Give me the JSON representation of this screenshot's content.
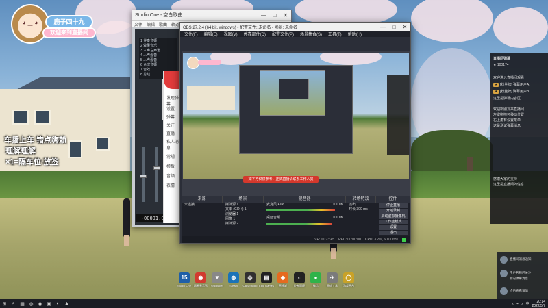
{
  "streamer": {
    "name": "鹿子四十九",
    "subtitle": "欢迎来到直播间",
    "avatar_face": "◕ ‿ ◕",
    "banner_line1": "车播上车 错点嗨赖",
    "banner_line2": "理解理解",
    "banner_line3": "×1=隔车位·放签"
  },
  "studio_one": {
    "title": "Studio One - 空白歌曲",
    "menu": [
      "文件",
      "编辑",
      "歌曲",
      "轨道",
      "事件",
      "音频",
      "视图"
    ],
    "tracks": [
      "1 伴奏音频",
      "2 效果音乐",
      "3 人声左声道",
      "4 人声混音",
      "5 人声混音",
      "6 合成音频",
      "7 音效",
      "8 总线"
    ],
    "time_display": "-00001.03.0"
  },
  "chat_settings": {
    "items": [
      "发现弹幕",
      "设置",
      "弹幕",
      "关注",
      "直播",
      "私人消息",
      "常规",
      "模板",
      "音频",
      "表情"
    ]
  },
  "obs": {
    "title": "OBS 27.2.4 (64 bit, windows) - 配置文件: 未命名 - 场景: 未命名",
    "menu": [
      "文件(F)",
      "编辑(E)",
      "视图(V)",
      "停靠部件(D)",
      "配置文件(P)",
      "场景集合(S)",
      "工具(T)",
      "帮助(H)"
    ],
    "preview_banner": "如下方仅供参考，正式直播请联系工作人员",
    "dock_headers": [
      "来源",
      "场景",
      "混音器",
      "转场特效",
      "控件"
    ],
    "sources_title": "未连接",
    "scenes": [
      "媒体源 1",
      "文本 (GDI+) 1",
      "浏览器 1",
      "图像 1",
      "媒体源 2"
    ],
    "mixer": [
      {
        "label": "麦克风/Aux",
        "value": "0.0 dB"
      },
      {
        "label": "桌面音频",
        "value": "0.0 dB"
      }
    ],
    "transition": {
      "type": "淡出",
      "duration_label": "时长",
      "duration_value": "300 ms"
    },
    "controls": [
      "停止直播",
      "开始录制",
      "启动虚拟摄像机",
      "工作室模式",
      "设置",
      "退出"
    ],
    "status": [
      "LIVE: 01:23:45",
      "REC: 00:00:00",
      "CPU: 3.2%, 60.00 fps"
    ]
  },
  "chat_dock": {
    "lines": [
      "直播间弹幕",
      "★ 100174",
      "欢迎进入直播间观看",
      "[粉丝牌] 弹幕用户A",
      "[粉丝牌] 弹幕用户B",
      "这里是弹幕内容区",
      "欢迎新朋友来直播间",
      "左键拖拽可移动位置",
      "右上角有设置菜单",
      "这是测试弹幕消息",
      "感谢大家的支持",
      "这里是直播间的信息"
    ]
  },
  "desktop_icons": [
    {
      "glyph": "15",
      "color": "#1f5fa8",
      "label": "Studio One"
    },
    {
      "glyph": "◉",
      "color": "#d13a2f",
      "label": "网易云音乐"
    },
    {
      "glyph": "▼",
      "color": "#888888",
      "label": "Wallpaper"
    },
    {
      "glyph": "◍",
      "color": "#1a73b8",
      "label": "Steam"
    },
    {
      "glyph": "◎",
      "color": "#303030",
      "label": "OBS Studio"
    },
    {
      "glyph": "▤",
      "color": "#222222",
      "label": "Epic Games"
    },
    {
      "glyph": "◆",
      "color": "#e56a1f",
      "label": "直播姬"
    },
    {
      "glyph": "◐",
      "color": "#222222",
      "label": "控制面板"
    },
    {
      "glyph": "●",
      "color": "#2fb34a",
      "label": "微信"
    },
    {
      "glyph": "✈",
      "color": "#7b7b7b",
      "label": "网络工具"
    },
    {
      "glyph": "◯",
      "color": "#c9a227",
      "label": "游戏平台"
    }
  ],
  "notification": {
    "lines": [
      "直播间消息通知",
      "用户名称已关注",
      "新的弹幕消息",
      "点击查看详情"
    ]
  },
  "taskbar": {
    "pinned": [
      "⊞",
      "⌕",
      "▦",
      "◍",
      "◉",
      "▣",
      "◐",
      "▲"
    ],
    "tray": [
      "∧",
      "⌁",
      "♪",
      "中"
    ],
    "time": "20:14",
    "date": "2022/5/7"
  }
}
